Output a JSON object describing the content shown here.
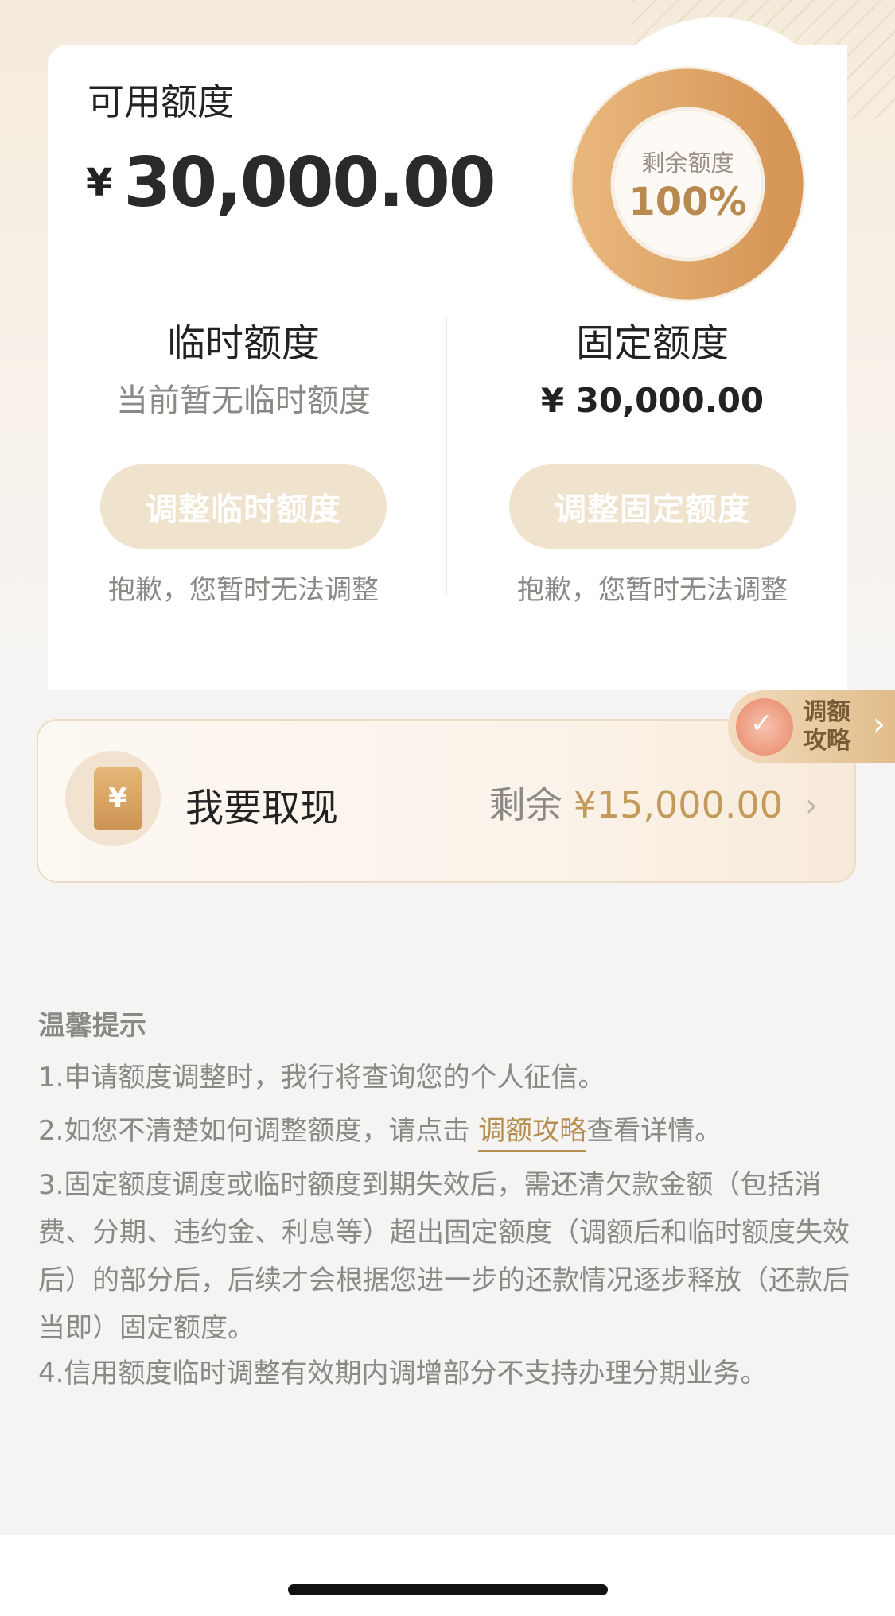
{
  "credit": {
    "available_label": "可用额度",
    "currency_symbol": "¥",
    "available_amount": "30,000.00",
    "ring": {
      "label": "剩余额度",
      "percent": "100%",
      "fraction": 1.0,
      "color_start": "#e0a866",
      "color_end": "#d79a59"
    }
  },
  "temporary": {
    "title": "临时额度",
    "status": "当前暂无临时额度",
    "button_label": "调整临时额度",
    "note": "抱歉，您暂时无法调整"
  },
  "fixed": {
    "title": "固定额度",
    "value": "¥ 30,000.00",
    "button_label": "调整固定额度",
    "note": "抱歉，您暂时无法调整"
  },
  "strategy_tag": {
    "line1": "调额",
    "line2": "攻略"
  },
  "cash": {
    "icon_symbol": "¥",
    "title": "我要取现",
    "remain_label": "剩余",
    "remain_value": "¥15,000.00"
  },
  "tips": {
    "title": "温馨提示",
    "item1": "1.申请额度调整时，我行将查询您的个人征信。",
    "item2_pre": "2.如您不清楚如何调整额度，请点击 ",
    "item2_link": "调额攻略",
    "item2_post": "查看详情。",
    "item3": "3.固定额度调度或临时额度到期失效后，需还清欠款金额（包括消费、分期、违约金、利息等）超出固定额度（调额后和临时额度失效后）的部分后，后续才会根据您进一步的还款情况逐步释放（还款后当即）固定额度。",
    "item4": "4.信用额度临时调整有效期内调增部分不支持办理分期业务。"
  },
  "colors": {
    "accent_gold": "#c29a5a",
    "button_disabled": "#efe3cd"
  }
}
